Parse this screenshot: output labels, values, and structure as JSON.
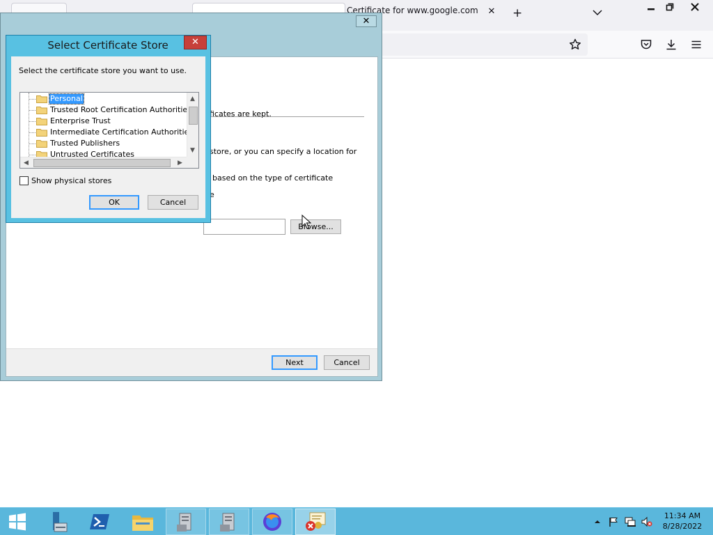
{
  "browser": {
    "active_tab_title": "Certificate for www.google.com",
    "close_tab_glyph": "✕",
    "new_tab_glyph": "+",
    "window_controls": [
      "minimize-icon",
      "restore-icon",
      "close-icon"
    ],
    "toolbar_icons": [
      "bookmark-star-icon",
      "pocket-icon",
      "downloads-icon",
      "menu-icon"
    ]
  },
  "wizard": {
    "close_glyph": "✕",
    "text_fragments": {
      "kept": "ficates are kept.",
      "store_location": "store, or you can specify a location for",
      "type_based": "based on the type of certificate",
      "trailing": "e"
    },
    "browse_label": "Browse...",
    "next_label": "Next",
    "cancel_label": "Cancel"
  },
  "dialog": {
    "title": "Select Certificate Store",
    "close_glyph": "✕",
    "prompt": "Select the certificate store you want to use.",
    "stores": [
      "Personal",
      "Trusted Root Certification Authorities",
      "Enterprise Trust",
      "Intermediate Certification Authorities",
      "Trusted Publishers",
      "Untrusted Certificates"
    ],
    "selected_store": "Personal",
    "show_physical_label": "Show physical stores",
    "show_physical_checked": false,
    "ok_label": "OK",
    "cancel_label": "Cancel"
  },
  "taskbar": {
    "items": [
      "start-button",
      "server-manager-icon",
      "powershell-icon",
      "file-explorer-icon",
      "server-app-icon",
      "server-app-icon-2",
      "firefox-icon",
      "certificate-manager-icon"
    ],
    "clock_time": "11:34 AM",
    "clock_date": "8/28/2022"
  },
  "colors": {
    "dialog_frame": "#58c1e2",
    "close_button": "#c7403a",
    "taskbar": "#5ab7dc",
    "selection": "#3399ff"
  }
}
